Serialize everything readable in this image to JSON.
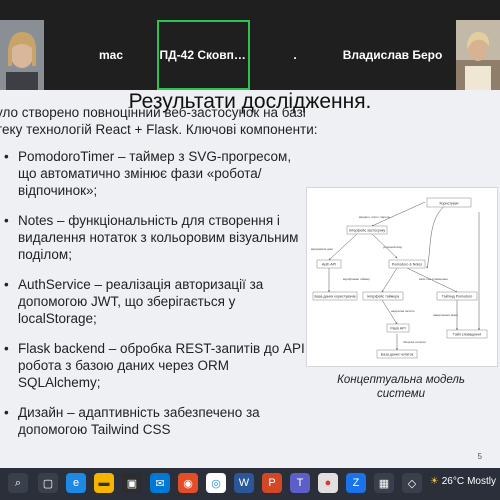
{
  "participants": [
    {
      "name": "mac"
    },
    {
      "name": "ПД-42 Сковпен..."
    },
    {
      "name": "."
    },
    {
      "name": "Владислав Беро"
    }
  ],
  "slide": {
    "title": "Результати дослідження.",
    "intro_line1": "уло створено повноцінний веб-застосунок на базі",
    "intro_line2": "теку технологій React + Flask. Ключові компоненти:",
    "bullets": [
      "PomodoroTimer – таймер з SVG-прогресом, що автоматично змінює фази «робота/відпочинок»;",
      "Notes – функціональність для створення і видалення нотаток з кольоровим візуальним поділом;",
      "AuthService – реалізація авторизації за допомогою JWT, що зберігається у localStorage;",
      "Flask backend – обробка REST-запитів до API, робота з базою даних через ORM SQLAlchemy;",
      "Дизайн – адаптивність забезпечено за допомогою Tailwind CSS"
    ],
    "caption_line1": "Концептуальна модель",
    "caption_line2": "системи",
    "page_number": "5"
  },
  "diagram": {
    "nodes": [
      "Користувач",
      "Інтерфейс застосунку",
      "Auth API",
      "Pomodoro & Notes",
      "База даних користувачів",
      "Інтерфейс таймера",
      "Тайлінд Pomodoro",
      "Flask API",
      "База даних нотаток",
      "Тайл сповіщення"
    ],
    "edges": [
      "вводить логін і пароль",
      "відправляє дані",
      "успішний вхід",
      "відображає таймер",
      "надсилає запити",
      "запит на сповіщення",
      "зберігає нотатки",
      "завершення фази"
    ]
  },
  "taskbar": {
    "temperature": "26°C",
    "weather": "Mostly"
  },
  "colors": {
    "active_border": "#2ec24f",
    "taskbar_bg": "#2b2f3a",
    "slide_bg": "#eef0f3"
  }
}
